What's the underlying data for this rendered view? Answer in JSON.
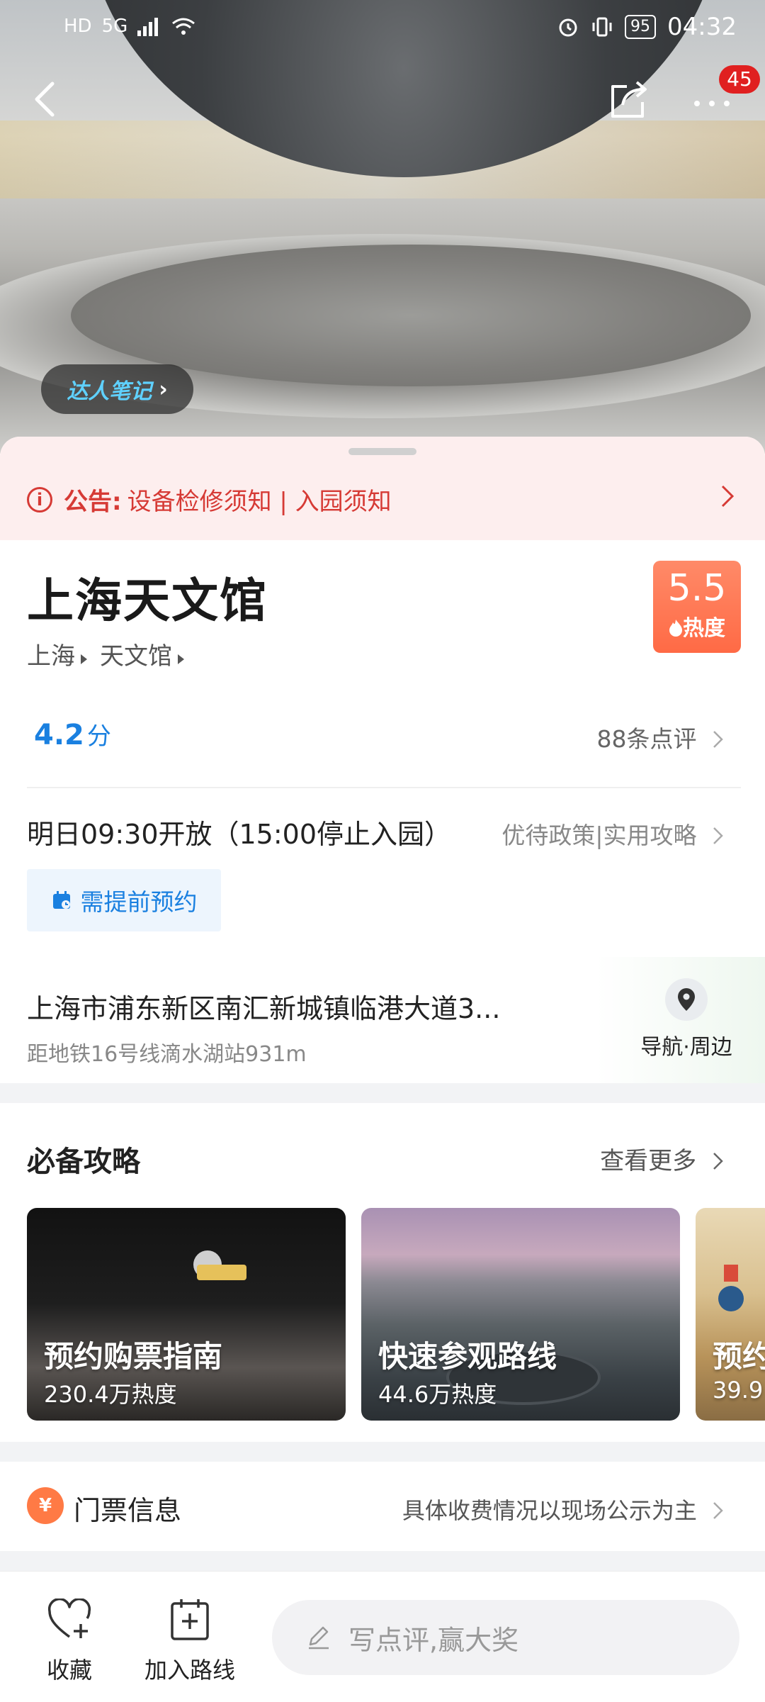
{
  "status_bar": {
    "left_icons": [
      "HD",
      "5G"
    ],
    "battery": "95",
    "time": "04:32"
  },
  "header": {
    "more_badge": "45"
  },
  "hero": {
    "notes_label": "达人笔记"
  },
  "notice": {
    "label": "公告:",
    "text": "设备检修须知 | 入园须知"
  },
  "place": {
    "title": "上海天文馆",
    "breadcrumbs": [
      "上海",
      "天文馆"
    ],
    "heat_value": "5.5",
    "heat_label": "热度",
    "rating_value": "4.2",
    "rating_unit": "分",
    "reviews": "88条点评",
    "hours": "明日09:30开放（15:00停止入园）",
    "policy_link": "优待政策|实用攻略",
    "reserve_label": "需提前预约",
    "address": "上海市浦东新区南汇新城镇临港大道3...",
    "address_sub": "距地铁16号线滴水湖站931m",
    "nav_label": "导航·周边"
  },
  "guides": {
    "title": "必备攻略",
    "more": "查看更多",
    "cards": [
      {
        "title": "预约购票指南",
        "heat": "230.4万热度"
      },
      {
        "title": "快速参观路线",
        "heat": "44.6万热度"
      },
      {
        "title": "预约",
        "heat": "39.9"
      }
    ]
  },
  "tickets": {
    "title": "门票信息",
    "note": "具体收费情况以现场公示为主",
    "icon": "¥"
  },
  "bottom_bar": {
    "favorite": "收藏",
    "add_route": "加入路线",
    "comment_placeholder": "写点评,赢大奖"
  },
  "colors": {
    "accent_blue": "#1a80e0",
    "notice_red": "#d63a35",
    "heat_orange": "#ff6a45"
  }
}
